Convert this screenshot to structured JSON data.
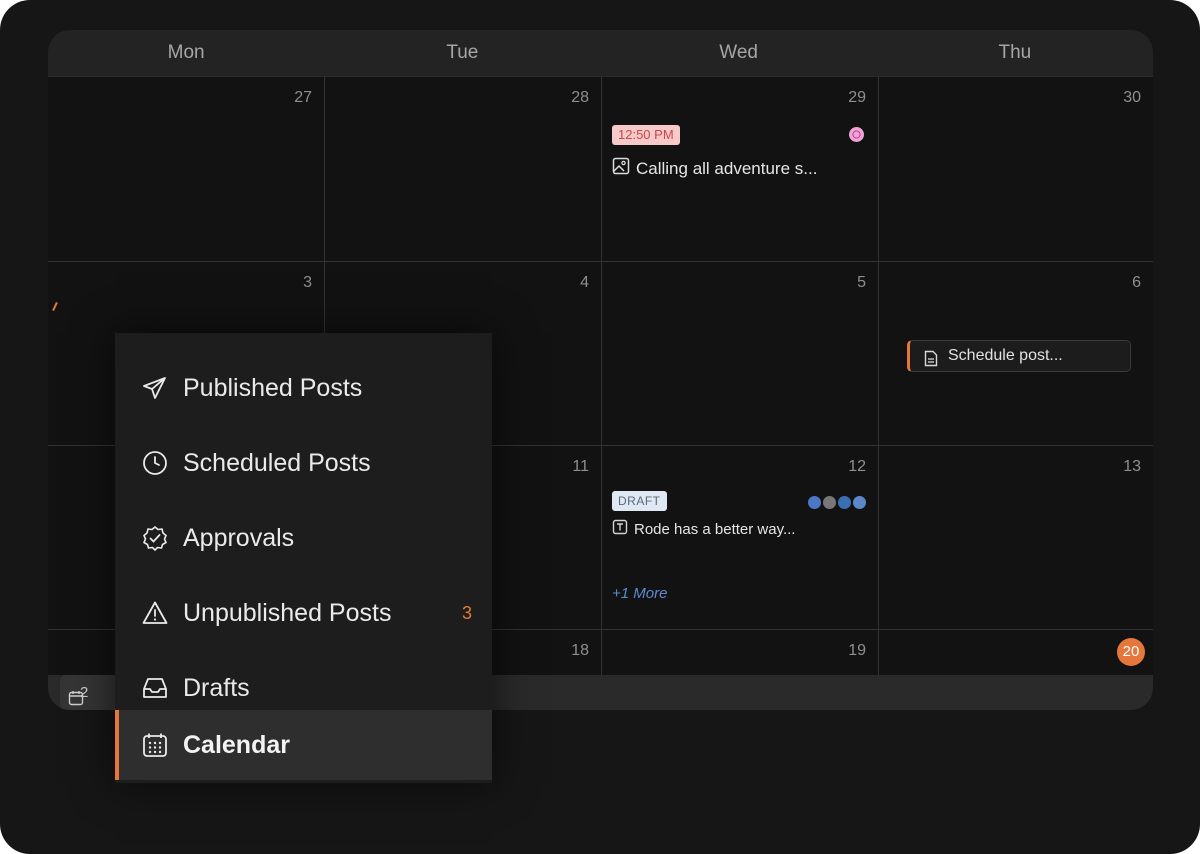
{
  "calendar": {
    "days": [
      "Mon",
      "Tue",
      "Wed",
      "Thu"
    ],
    "rows": [
      [
        "27",
        "28",
        "29",
        "30"
      ],
      [
        "3",
        "4",
        "5",
        "6"
      ],
      [
        "",
        "11",
        "12",
        "13"
      ],
      [
        "",
        "18",
        "19",
        "20"
      ]
    ],
    "today": "20",
    "footer_date_partial": "2"
  },
  "events": {
    "wed29": {
      "time": "12:50 PM",
      "title": "Calling all adventure s..."
    },
    "thu6": {
      "title": "Schedule post..."
    },
    "wed12": {
      "status": "DRAFT",
      "title": "Rode has a better way...",
      "more": "+1 More"
    }
  },
  "menu": {
    "items": [
      {
        "label": "Published Posts",
        "icon": "paper-plane-icon"
      },
      {
        "label": "Scheduled Posts",
        "icon": "clock-icon"
      },
      {
        "label": "Approvals",
        "icon": "check-badge-icon"
      },
      {
        "label": "Unpublished Posts",
        "icon": "warning-icon",
        "count": "3"
      },
      {
        "label": "Drafts",
        "icon": "inbox-tray-icon"
      },
      {
        "label": "Calendar",
        "icon": "calendar-icon",
        "active": true
      }
    ]
  },
  "colors": {
    "accent": "#e6773b",
    "background": "#161616",
    "time_badge_bg": "#f7c9c9",
    "draft_badge_bg": "#dfe8f3",
    "more_link": "#5d8bd0"
  }
}
